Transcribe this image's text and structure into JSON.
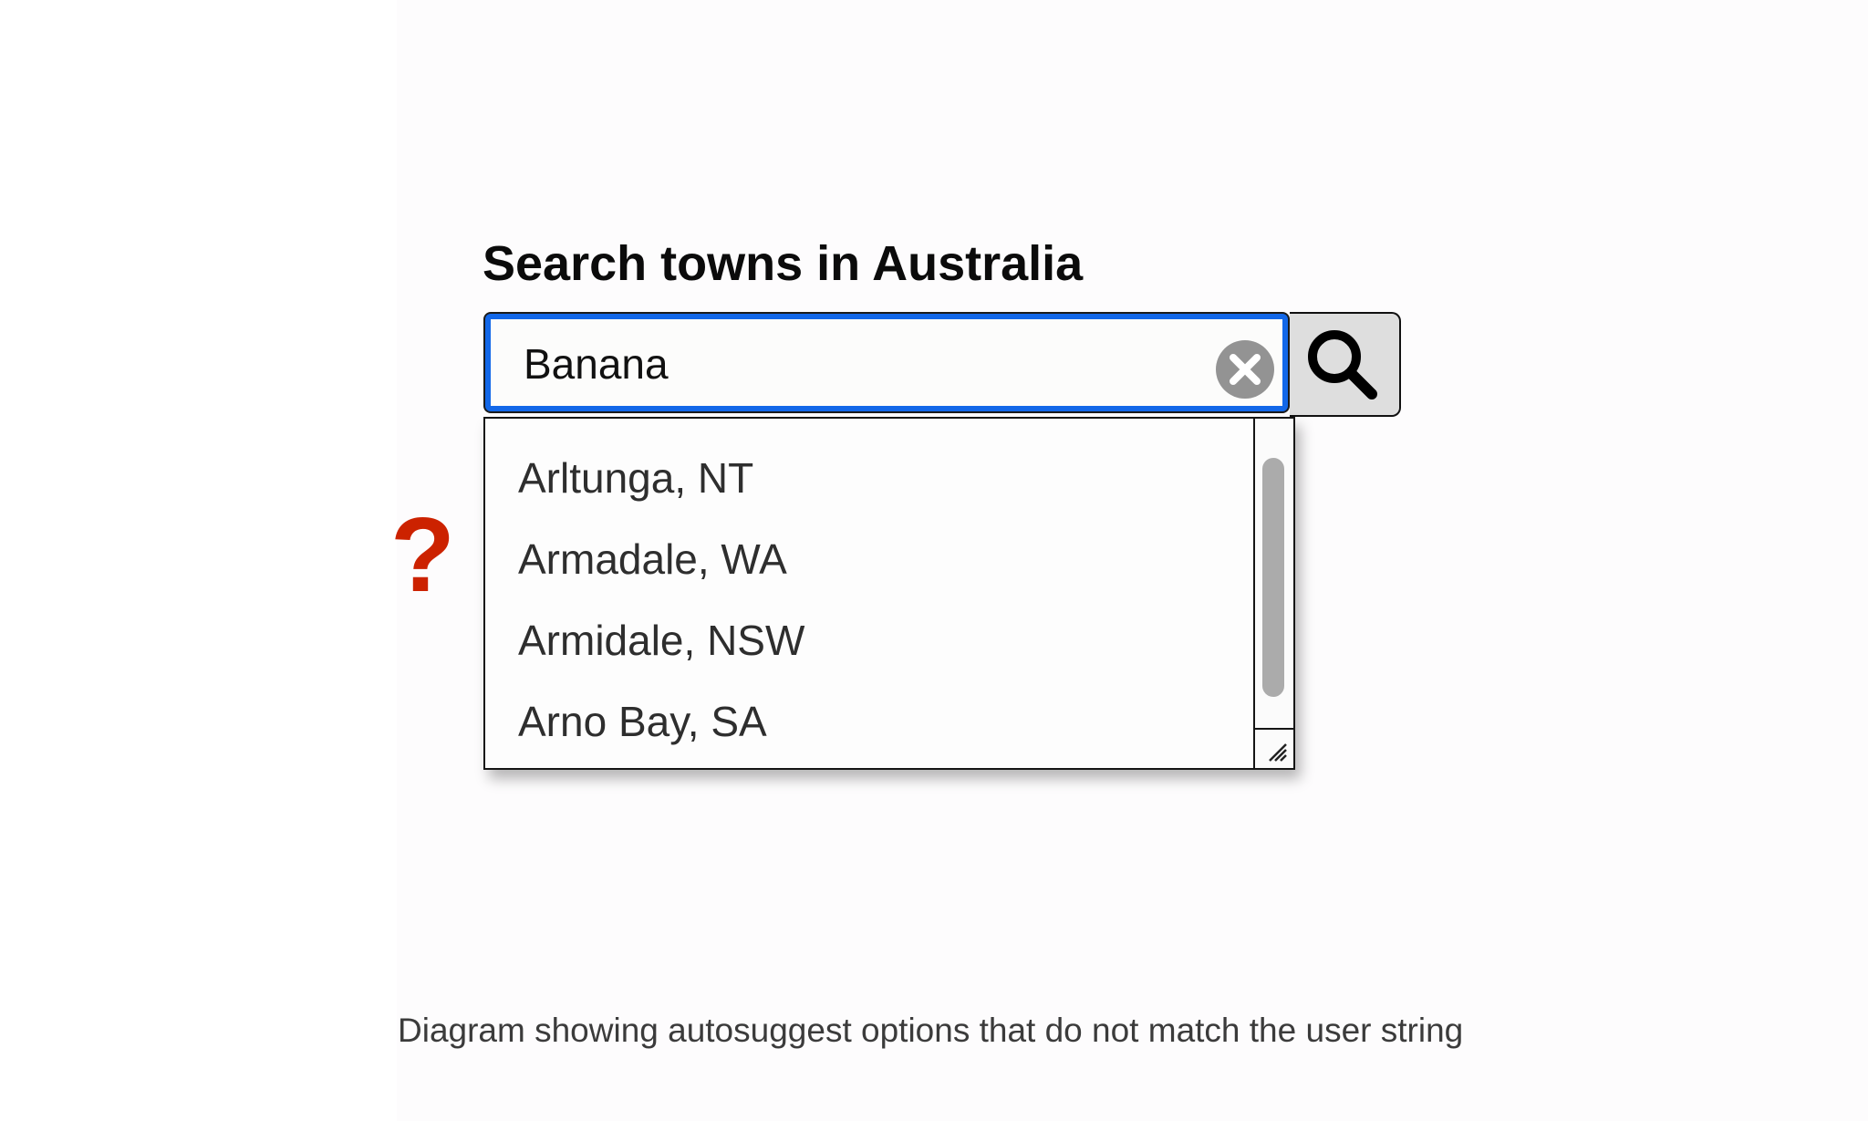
{
  "heading": "Search towns in Australia",
  "search": {
    "value": "Banana",
    "clear_icon": "clear-circle-x-icon",
    "button_icon": "magnifier-icon",
    "focus_color": "#1267e8"
  },
  "suggestions": [
    "Arltunga, NT",
    "Armadale, WA",
    "Armidale, NSW",
    "Arno Bay, SA"
  ],
  "marker": {
    "text": "?",
    "color": "#cc2200"
  },
  "caption": "Diagram showing autosuggest options that do not match the user string"
}
